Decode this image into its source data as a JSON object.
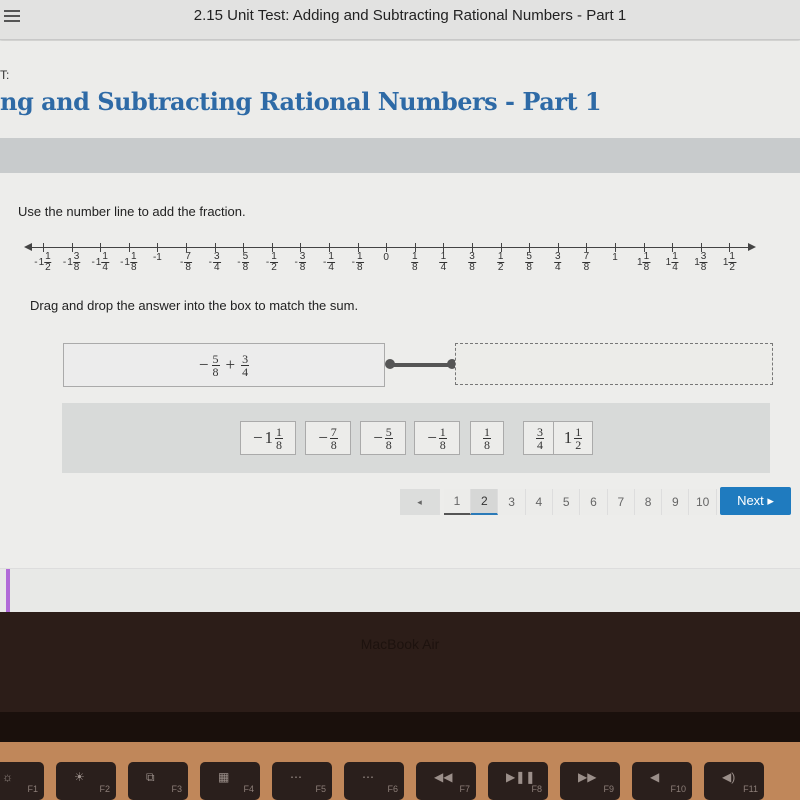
{
  "topbar": {
    "menu_icon": "hamburger-menu-icon",
    "title": "2.15 Unit Test: Adding and Subtracting Rational Numbers - Part 1"
  },
  "header": {
    "label": "T:",
    "title": "ng and Subtracting Rational Numbers - Part 1"
  },
  "question": {
    "instruction": "Use the number line to add the fraction.",
    "number_line": {
      "ticks": [
        {
          "sign": "-",
          "whole": "1",
          "num": "1",
          "den": "2"
        },
        {
          "sign": "-",
          "whole": "1",
          "num": "3",
          "den": "8"
        },
        {
          "sign": "-",
          "whole": "1",
          "num": "1",
          "den": "4"
        },
        {
          "sign": "-",
          "whole": "1",
          "num": "1",
          "den": "8"
        },
        {
          "sign": "",
          "whole": "-1",
          "num": "",
          "den": ""
        },
        {
          "sign": "-",
          "whole": "",
          "num": "7",
          "den": "8"
        },
        {
          "sign": "-",
          "whole": "",
          "num": "3",
          "den": "4"
        },
        {
          "sign": "-",
          "whole": "",
          "num": "5",
          "den": "8"
        },
        {
          "sign": "-",
          "whole": "",
          "num": "1",
          "den": "2"
        },
        {
          "sign": "-",
          "whole": "",
          "num": "3",
          "den": "8"
        },
        {
          "sign": "-",
          "whole": "",
          "num": "1",
          "den": "4"
        },
        {
          "sign": "-",
          "whole": "",
          "num": "1",
          "den": "8"
        },
        {
          "sign": "",
          "whole": "0",
          "num": "",
          "den": ""
        },
        {
          "sign": "",
          "whole": "",
          "num": "1",
          "den": "8"
        },
        {
          "sign": "",
          "whole": "",
          "num": "1",
          "den": "4"
        },
        {
          "sign": "",
          "whole": "",
          "num": "3",
          "den": "8"
        },
        {
          "sign": "",
          "whole": "",
          "num": "1",
          "den": "2"
        },
        {
          "sign": "",
          "whole": "",
          "num": "5",
          "den": "8"
        },
        {
          "sign": "",
          "whole": "",
          "num": "3",
          "den": "4"
        },
        {
          "sign": "",
          "whole": "",
          "num": "7",
          "den": "8"
        },
        {
          "sign": "",
          "whole": "1",
          "num": "",
          "den": ""
        },
        {
          "sign": "",
          "whole": "1",
          "num": "1",
          "den": "8"
        },
        {
          "sign": "",
          "whole": "1",
          "num": "1",
          "den": "4"
        },
        {
          "sign": "",
          "whole": "1",
          "num": "3",
          "den": "8"
        },
        {
          "sign": "",
          "whole": "1",
          "num": "1",
          "den": "2"
        }
      ]
    },
    "drag_instruction": "Drag and drop the answer into the box to match the sum.",
    "expression": {
      "a_sign": "−",
      "a_num": "5",
      "a_den": "8",
      "op": "+",
      "b_num": "3",
      "b_den": "4"
    },
    "drop_target_value": "",
    "tiles": [
      {
        "sign": "−",
        "whole": "1",
        "num": "1",
        "den": "8"
      },
      {
        "sign": "−",
        "whole": "",
        "num": "7",
        "den": "8"
      },
      {
        "sign": "−",
        "whole": "",
        "num": "5",
        "den": "8"
      },
      {
        "sign": "−",
        "whole": "",
        "num": "1",
        "den": "8"
      },
      {
        "sign": "",
        "whole": "",
        "num": "1",
        "den": "8"
      },
      {
        "sign": "",
        "whole": "",
        "num": "3",
        "den": "4"
      },
      {
        "sign": "",
        "whole": "1",
        "num": "1",
        "den": "2"
      }
    ]
  },
  "pagination": {
    "prev_icon": "prev-triangle-icon",
    "prev_glyph": "◂",
    "pages": [
      "1",
      "2",
      "3",
      "4",
      "5",
      "6",
      "7",
      "8",
      "9",
      "10"
    ],
    "current_page": "2",
    "next_label": "Next ▸"
  },
  "device": {
    "brand": "MacBook Air",
    "keys": [
      {
        "glyph": "☼",
        "label": "F1"
      },
      {
        "glyph": "☀",
        "label": "F2"
      },
      {
        "glyph": "⧉",
        "label": "F3"
      },
      {
        "glyph": "▦",
        "label": "F4"
      },
      {
        "glyph": "⋯",
        "label": "F5"
      },
      {
        "glyph": "⋯",
        "label": "F6"
      },
      {
        "glyph": "◀◀",
        "label": "F7"
      },
      {
        "glyph": "▶❚❚",
        "label": "F8"
      },
      {
        "glyph": "▶▶",
        "label": "F9"
      },
      {
        "glyph": "◀",
        "label": "F10"
      },
      {
        "glyph": "◀)",
        "label": "F11"
      }
    ]
  },
  "colors": {
    "accent": "#1f7bbf",
    "title_blue": "#2e6aa6"
  }
}
